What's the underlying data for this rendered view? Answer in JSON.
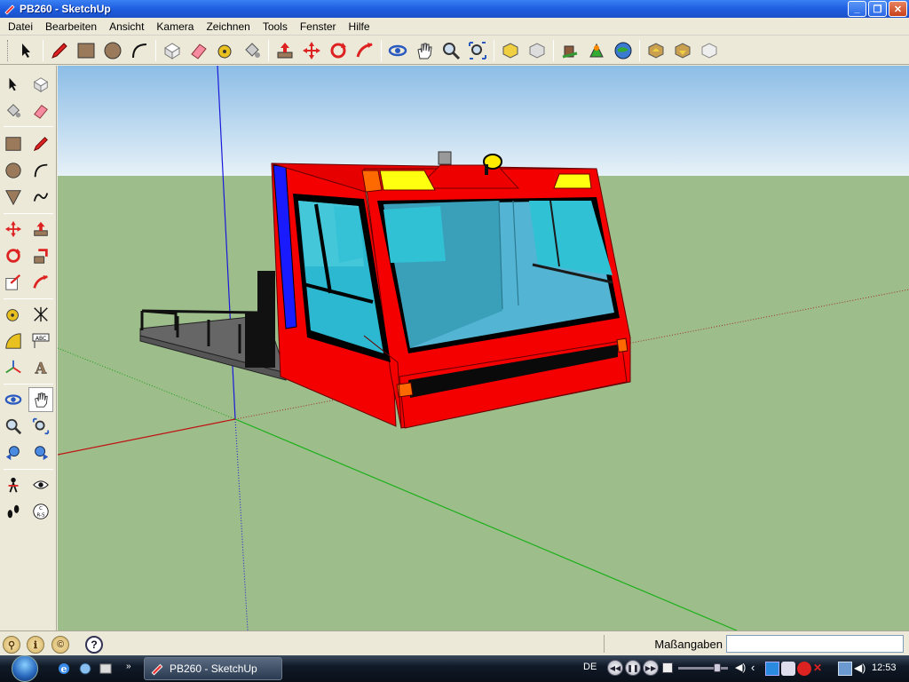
{
  "window": {
    "title": "PB260 - SketchUp"
  },
  "menu": [
    "Datei",
    "Bearbeiten",
    "Ansicht",
    "Kamera",
    "Zeichnen",
    "Tools",
    "Fenster",
    "Hilfe"
  ],
  "toolbar": {
    "tools": [
      "select-icon",
      "pencil-icon",
      "rectangle-icon",
      "circle-icon",
      "arc-icon",
      "make-component-icon",
      "eraser-icon",
      "tape-measure-icon",
      "paint-bucket-icon",
      "push-pull-icon",
      "move-icon",
      "rotate-icon",
      "follow-me-icon",
      "orbit-icon",
      "pan-icon",
      "zoom-icon",
      "zoom-extents-icon",
      "get-models-icon",
      "share-model-icon",
      "share-component-icon",
      "place-model-icon",
      "get-current-view-icon",
      "toggle-terrain-icon",
      "preview-google-earth-icon",
      "get-photo-texture-icon",
      "add-location-icon"
    ]
  },
  "left_toolbar": {
    "tools": [
      "select-icon",
      "make-component-icon",
      "paint-bucket-icon",
      "eraser-icon",
      "rectangle-icon",
      "line-icon",
      "circle-icon",
      "arc-icon",
      "polygon-icon",
      "freehand-icon",
      "move-icon",
      "push-pull-icon",
      "rotate-icon",
      "follow-me-icon",
      "scale-icon",
      "offset-icon",
      "tape-measure-icon",
      "dimension-icon",
      "protractor-icon",
      "text-icon",
      "axes-icon",
      "3d-text-icon",
      "orbit-icon",
      "pan-icon",
      "zoom-icon",
      "zoom-window-icon",
      "previous-view-icon",
      "next-view-icon",
      "position-camera-icon",
      "look-around-icon",
      "walk-icon",
      "section-plane-icon"
    ]
  },
  "status": {
    "measurements_label": "Maßangaben",
    "measurements_value": ""
  },
  "taskbar": {
    "task_label": "PB260 - SketchUp",
    "language": "DE",
    "clock": "12:53"
  },
  "colors": {
    "sky_top": "#9cc8e8",
    "ground": "#9dbd8b",
    "cab_red": "#f40000",
    "glass": "#38c2d2",
    "stripe_blue": "#1a1aff"
  }
}
